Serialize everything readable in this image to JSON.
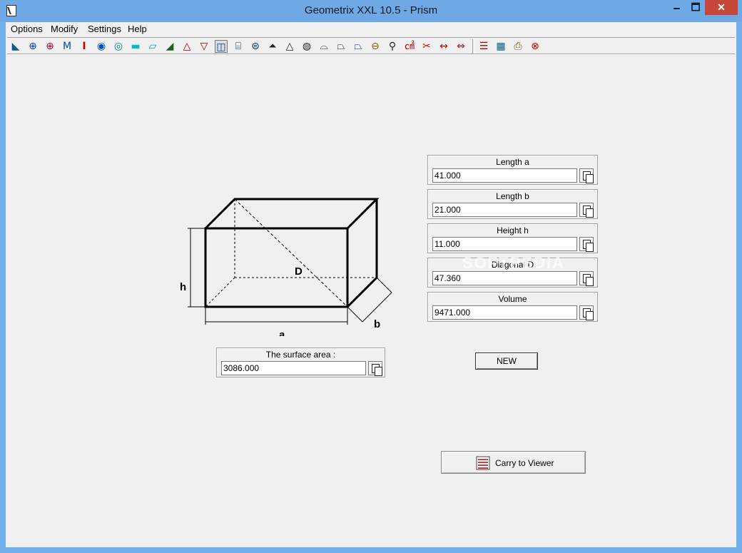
{
  "window": {
    "title": "Geometrix XXL 10.5 - Prism",
    "minimize": "🗕",
    "maximize": "🗖",
    "close": "✕"
  },
  "menu": [
    {
      "label": "Options"
    },
    {
      "label": "Modify"
    },
    {
      "label": "Settings"
    },
    {
      "label": "Help"
    }
  ],
  "toolbar_icons": [
    "area-tool-icon",
    "circle-cross-icon",
    "circle-cross-red-icon",
    "m-profile-icon",
    "i-beam-icon",
    "circle-target-icon",
    "circle-target-2-icon",
    "rectangle-icon",
    "parallelogram-icon",
    "right-triangle-icon",
    "triangle-icon",
    "cone-icon",
    "prism-icon",
    "cylinder-icon",
    "barrel-icon",
    "pyramid-icon",
    "tetrahedron-icon",
    "sphere-icon",
    "spherical-cap-icon",
    "frustum-icon",
    "truncated-cone-icon",
    "torus-icon",
    "weight-icon",
    "calc-icon",
    "scissors-icon",
    "dimension-icon",
    "measure-icon",
    "list-icon",
    "calculator-icon",
    "printer-icon",
    "exit-icon"
  ],
  "drawing": {
    "label_a": "a",
    "label_b": "b",
    "label_h": "h",
    "label_D": "D"
  },
  "fields": {
    "length_a": {
      "label": "Length a",
      "value": "41.000"
    },
    "length_b": {
      "label": "Length b",
      "value": "21.000"
    },
    "height_h": {
      "label": "Height h",
      "value": "11.000"
    },
    "diagonal_d": {
      "label": "Diagonal D",
      "value": "47.360"
    },
    "volume": {
      "label": "Volume",
      "value": "9471.000"
    },
    "surface_area": {
      "label": "The surface area :",
      "value": "3086.000"
    }
  },
  "buttons": {
    "new": "NEW",
    "carry": "Carry to Viewer"
  },
  "watermark": "SOFTPEDIA"
}
